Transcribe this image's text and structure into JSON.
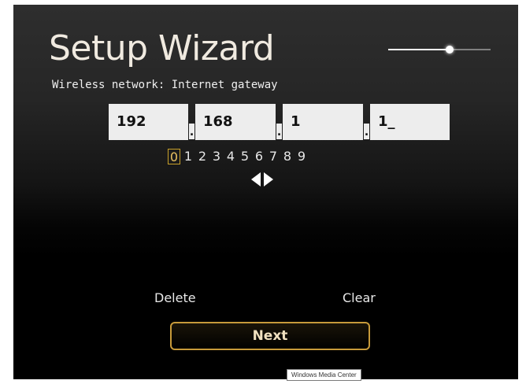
{
  "app": "Windows Media Center",
  "header": {
    "title": "Setup Wizard",
    "subtitle": "Wireless network: Internet gateway"
  },
  "progress_slider": {
    "fraction": 0.6
  },
  "ip_fields": [
    "192",
    "168",
    "1",
    "1_"
  ],
  "ip_separator": ".",
  "digit_picker": {
    "digits": [
      "0",
      "1",
      "2",
      "3",
      "4",
      "5",
      "6",
      "7",
      "8",
      "9"
    ],
    "selected_index": 0
  },
  "arrows": {
    "left_icon": "triangle-left-icon",
    "right_icon": "triangle-right-icon"
  },
  "actions": {
    "delete_label": "Delete",
    "clear_label": "Clear",
    "next_label": "Next"
  },
  "tooltip": {
    "text": "Windows Media Center"
  },
  "colors": {
    "accent_border": "#c79a3a",
    "selected_digit": "#c9a12a",
    "field_bg": "#ededed"
  }
}
